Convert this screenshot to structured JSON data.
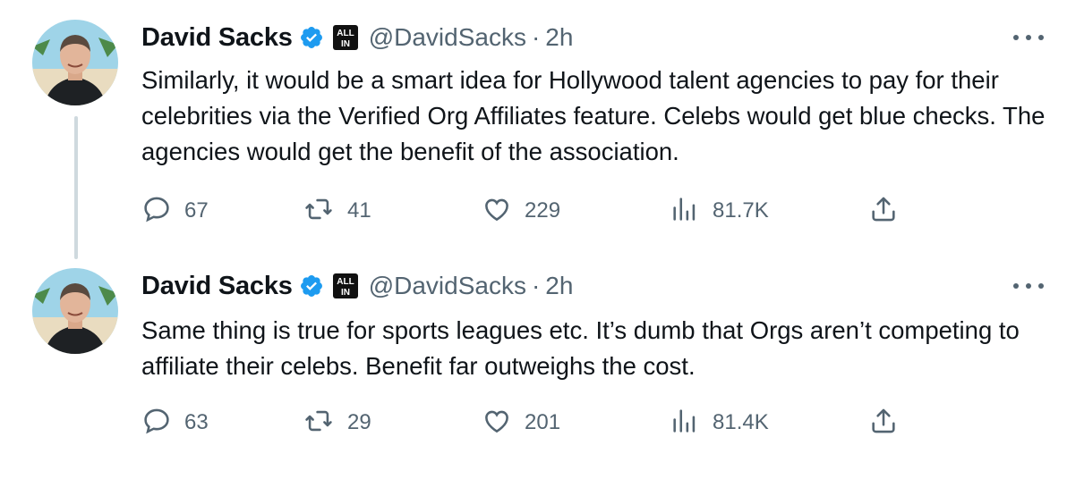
{
  "tweets": [
    {
      "author": {
        "name": "David Sacks",
        "handle": "@DavidSacks",
        "sep": "·",
        "time": "2h",
        "affiliate_badge": "ALL IN"
      },
      "text": "Similarly, it would be a smart idea for Hollywood talent agencies to pay for their celebrities via the Verified Org Affiliates feature. Celebs would get blue checks. The agencies would get the benefit of the association.",
      "stats": {
        "replies": "67",
        "reposts": "41",
        "likes": "229",
        "views": "81.7K"
      }
    },
    {
      "author": {
        "name": "David Sacks",
        "handle": "@DavidSacks",
        "sep": "·",
        "time": "2h",
        "affiliate_badge": "ALL IN"
      },
      "text": "Same thing is true for sports leagues etc. It’s dumb that Orgs aren’t competing to affiliate their celebs. Benefit far outweighs the cost.",
      "stats": {
        "replies": "63",
        "reposts": "29",
        "likes": "201",
        "views": "81.4K"
      }
    }
  ],
  "colors": {
    "verified": "#1d9bf0",
    "secondary_text": "#536471",
    "thread_line": "#cfd9de"
  },
  "icons": [
    "reply-icon",
    "repost-icon",
    "like-icon",
    "views-icon",
    "share-icon",
    "more-icon",
    "verified-icon"
  ]
}
